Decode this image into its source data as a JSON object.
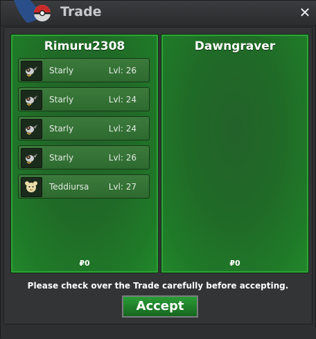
{
  "window": {
    "title": "Trade",
    "close_symbol": "✕"
  },
  "left_panel": {
    "player": "Rimuru2308",
    "money": "₽0",
    "items": [
      {
        "name": "Starly",
        "level": "Lvl: 26",
        "icon": "starly-icon"
      },
      {
        "name": "Starly",
        "level": "Lvl: 24",
        "icon": "starly-icon"
      },
      {
        "name": "Starly",
        "level": "Lvl: 24",
        "icon": "starly-icon"
      },
      {
        "name": "Starly",
        "level": "Lvl: 26",
        "icon": "starly-icon"
      },
      {
        "name": "Teddiursa",
        "level": "Lvl: 27",
        "icon": "teddiursa-icon"
      }
    ]
  },
  "right_panel": {
    "player": "Dawngraver",
    "money": "₽0",
    "items": []
  },
  "footer": {
    "notice": "Please check over the Trade carefully before accepting.",
    "accept_label": "Accept"
  },
  "colors": {
    "panel_green": "#206a27",
    "panel_border": "#2da436",
    "accept_green": "#2a9d36"
  }
}
